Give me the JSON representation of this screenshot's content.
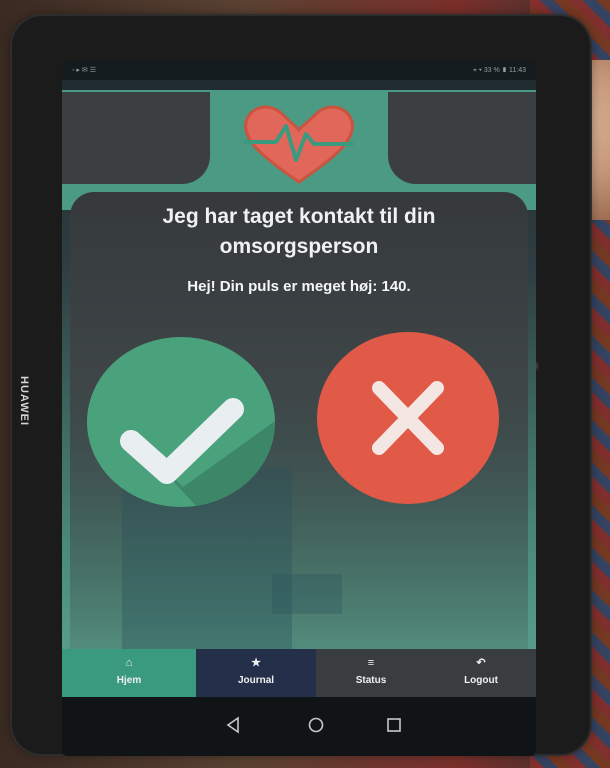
{
  "device": {
    "brand": "HUAWEI"
  },
  "statusbar": {
    "left": "◦ ▸ ✉ ☰",
    "right": "⌖ ▾ 33 % ▮ 11:43"
  },
  "message": {
    "headline_line1": "Jeg har taget kontakt til din",
    "headline_line2": "omsorgsperson",
    "subline": "Hej! Din puls er meget høj: 140."
  },
  "actions": {
    "confirm_icon": "checkmark-icon",
    "cancel_icon": "close-icon"
  },
  "nav": {
    "items": [
      {
        "label": "Hjem",
        "icon": "home-icon",
        "glyph": "⌂",
        "active": true
      },
      {
        "label": "Journal",
        "icon": "star-icon",
        "glyph": "★",
        "active": false
      },
      {
        "label": "Status",
        "icon": "menu-icon",
        "glyph": "≡",
        "active": false
      },
      {
        "label": "Logout",
        "icon": "undo-icon",
        "glyph": "↶",
        "active": false
      }
    ]
  },
  "colors": {
    "accent_green": "#4aa27d",
    "accent_red": "#e05a47",
    "teal": "#3a9a80",
    "navy": "#24304a",
    "card": "#3c3f41"
  }
}
